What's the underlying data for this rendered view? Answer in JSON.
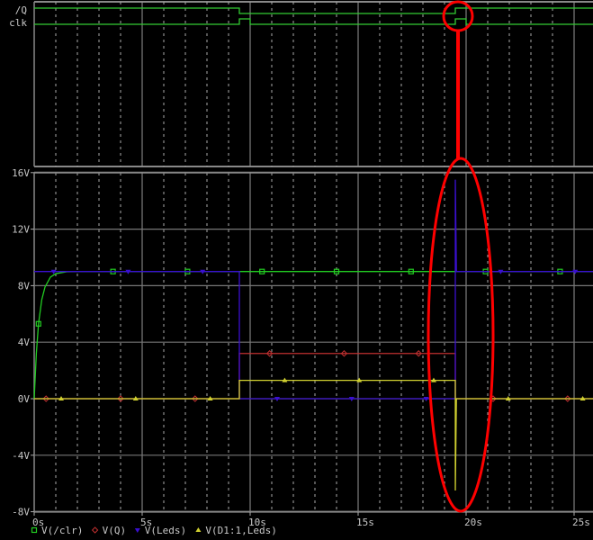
{
  "digital_panel": {
    "signals": [
      {
        "name": "/Q",
        "transitions": [
          [
            0,
            1
          ],
          [
            9.5,
            0
          ],
          [
            19.5,
            1
          ]
        ]
      },
      {
        "name": "clk",
        "transitions": [
          [
            0,
            0
          ],
          [
            9.5,
            1
          ],
          [
            10,
            0
          ],
          [
            19.5,
            1
          ],
          [
            20,
            0
          ]
        ]
      }
    ]
  },
  "chart_data": {
    "type": "line",
    "title": "",
    "xlabel": "",
    "ylabel": "",
    "xlim": [
      0,
      26
    ],
    "ylim": [
      -8,
      16
    ],
    "x_ticks": [
      0,
      5,
      10,
      15,
      20,
      25
    ],
    "x_tick_labels": [
      "0s",
      "5s",
      "10s",
      "15s",
      "20s",
      "25s"
    ],
    "y_ticks": [
      16,
      12,
      8,
      4,
      0,
      -4,
      -8
    ],
    "y_tick_labels": [
      "16V",
      "12V",
      "8V",
      "4V",
      "0V",
      "-4V",
      "-8V"
    ],
    "grid": true,
    "legend_position": "bottom-left",
    "series": [
      {
        "name": "V(/clr)",
        "color": "#22cc22",
        "marker": "square",
        "points": [
          [
            0,
            0
          ],
          [
            0.1,
            3.2
          ],
          [
            0.2,
            5.3
          ],
          [
            0.35,
            7.0
          ],
          [
            0.5,
            7.9
          ],
          [
            0.75,
            8.6
          ],
          [
            1,
            8.85
          ],
          [
            1.5,
            8.98
          ],
          [
            2,
            9
          ],
          [
            9.5,
            9
          ],
          [
            19.5,
            9
          ],
          [
            26,
            9
          ]
        ]
      },
      {
        "name": "V(Q)",
        "color": "#c03030",
        "marker": "diamond",
        "points": [
          [
            0,
            0
          ],
          [
            9.5,
            0
          ],
          [
            9.5,
            3.2
          ],
          [
            19.5,
            3.2
          ],
          [
            19.5,
            0
          ],
          [
            26,
            0
          ]
        ]
      },
      {
        "name": "V(Leds)",
        "color": "#3a10d0",
        "marker": "triangle-down",
        "points": [
          [
            0,
            9
          ],
          [
            9.5,
            9
          ],
          [
            9.5,
            0
          ],
          [
            19.5,
            0
          ],
          [
            19.5,
            15.5
          ],
          [
            19.55,
            9
          ],
          [
            26,
            9
          ]
        ]
      },
      {
        "name": "V(D1:1,Leds)",
        "color": "#d0d030",
        "marker": "triangle-up",
        "points": [
          [
            0,
            0
          ],
          [
            9.5,
            0
          ],
          [
            9.5,
            1.3
          ],
          [
            19.5,
            1.3
          ],
          [
            19.5,
            -6.5
          ],
          [
            19.55,
            0
          ],
          [
            26,
            0
          ]
        ]
      }
    ]
  },
  "annotation_color": "#ff0000"
}
